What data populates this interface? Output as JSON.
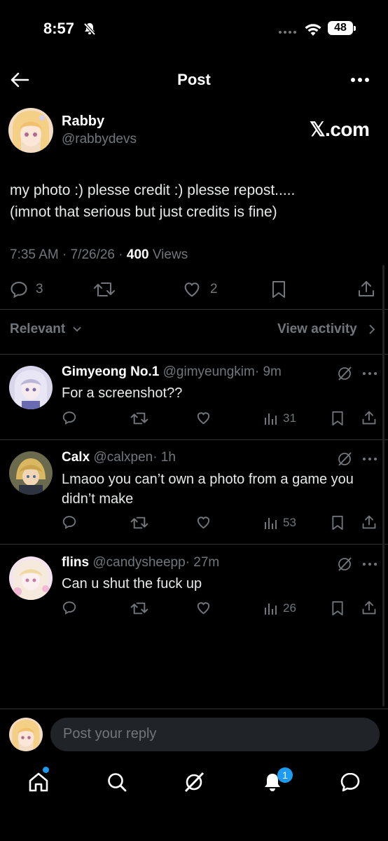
{
  "status_bar": {
    "time": "8:57",
    "battery": "48"
  },
  "header": {
    "title": "Post"
  },
  "post": {
    "author_name": "Rabby",
    "author_handle": "@rabbydevs",
    "source": "𝕏.com",
    "text_line1": "my photo :) plesse credit :) plesse repost.....",
    "text_line2": "(imnot that serious but just credits is fine)",
    "time": "7:35 AM · 7/26/26 · ",
    "views": "400",
    "views_label": " Views",
    "reply_count": "3",
    "like_count": "2"
  },
  "sort": {
    "relevant": "Relevant",
    "view_activity": "View activity"
  },
  "replies": [
    {
      "name": "Gimyeong No.1",
      "handle": "@gimyeungkim",
      "time": "· 9m",
      "text": "For a screenshot??",
      "views": "31"
    },
    {
      "name": "Calx",
      "handle": "@calxpen",
      "time": "· 1h",
      "text": "Lmaoo you can’t own a photo from a game you didn’t make",
      "views": "53"
    },
    {
      "name": "flins",
      "handle": "@candysheepp",
      "time": "· 27m",
      "text": "Can u shut the fuck up",
      "views": "26"
    }
  ],
  "composer": {
    "placeholder": "Post your reply"
  },
  "tabbar": {
    "notifications_badge": "1"
  },
  "colors": {
    "background": "#000000",
    "accent": "#1d9bf0",
    "muted": "#71767b"
  },
  "icons": [
    "back-arrow-icon",
    "more-icon",
    "reply-icon",
    "repost-icon",
    "like-icon",
    "bookmark-icon",
    "share-icon",
    "chevron-down-icon",
    "chevron-right-icon",
    "grok-icon",
    "views-icon",
    "home-icon",
    "search-icon",
    "notifications-icon",
    "messages-icon"
  ]
}
